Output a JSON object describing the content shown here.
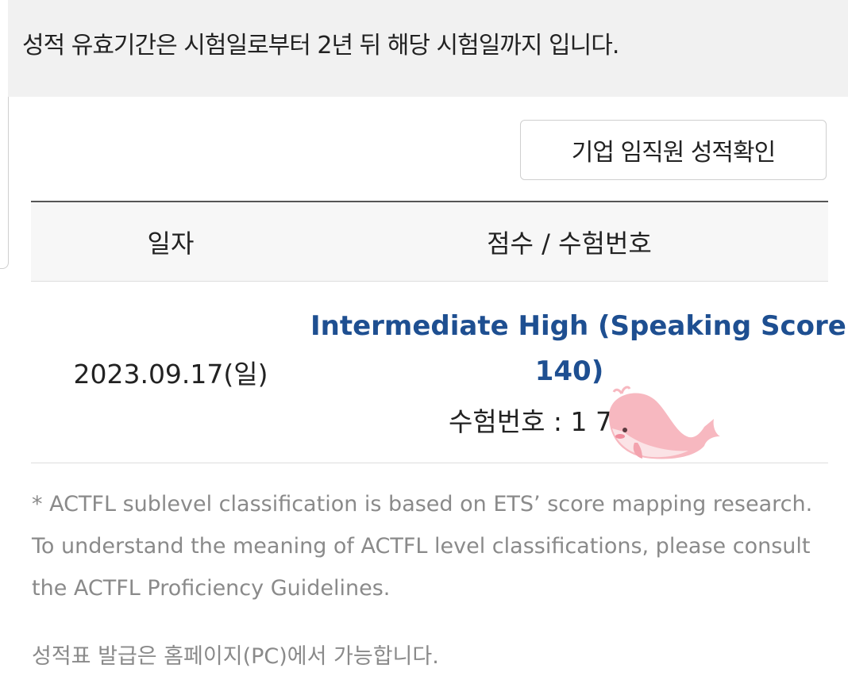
{
  "notice": {
    "text": "성적 유효기간은 시험일로부터 2년 뒤 해당 시험일까지 입니다."
  },
  "corporate_button": {
    "label": "기업 임직원 성적확인"
  },
  "table": {
    "headers": {
      "date": "일자",
      "score": "점수 / 수험번호"
    },
    "rows": [
      {
        "date": "2023.09.17(일)",
        "score_line1": "Intermediate High (Speaking Score",
        "score_line2": "140)",
        "exam_number": "수험번호 : 1        7"
      }
    ]
  },
  "notes": {
    "line1": "* ACTFL sublevel classification is based on ETS’ score mapping research.",
    "line2": "To understand the meaning of ACTFL level classifications, please consult",
    "line3": "the ACTFL Proficiency Guidelines."
  },
  "issue_notice": "성적표 발급은 홈페이지(PC)에서 가능합니다.",
  "colors": {
    "accent_blue": "#1e4f91",
    "whale_pink": "#f7b8c0"
  },
  "icons": {
    "whale_sticker": "whale-sticker-icon"
  }
}
